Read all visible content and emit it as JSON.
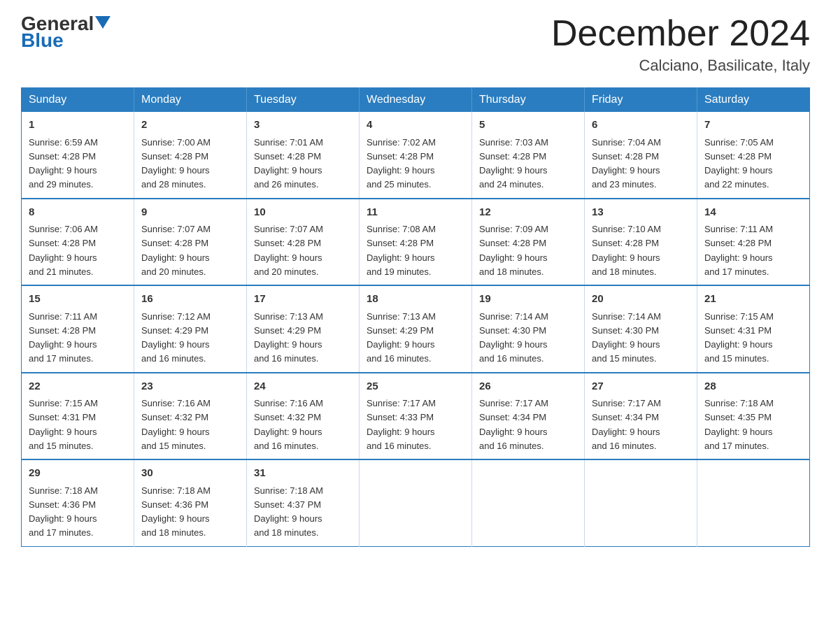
{
  "header": {
    "logo": {
      "general": "General",
      "blue": "Blue",
      "arrow": "▲"
    },
    "title": "December 2024",
    "location": "Calciano, Basilicate, Italy"
  },
  "days_of_week": [
    "Sunday",
    "Monday",
    "Tuesday",
    "Wednesday",
    "Thursday",
    "Friday",
    "Saturday"
  ],
  "weeks": [
    [
      {
        "day": "1",
        "sunrise": "6:59 AM",
        "sunset": "4:28 PM",
        "daylight": "9 hours and 29 minutes."
      },
      {
        "day": "2",
        "sunrise": "7:00 AM",
        "sunset": "4:28 PM",
        "daylight": "9 hours and 28 minutes."
      },
      {
        "day": "3",
        "sunrise": "7:01 AM",
        "sunset": "4:28 PM",
        "daylight": "9 hours and 26 minutes."
      },
      {
        "day": "4",
        "sunrise": "7:02 AM",
        "sunset": "4:28 PM",
        "daylight": "9 hours and 25 minutes."
      },
      {
        "day": "5",
        "sunrise": "7:03 AM",
        "sunset": "4:28 PM",
        "daylight": "9 hours and 24 minutes."
      },
      {
        "day": "6",
        "sunrise": "7:04 AM",
        "sunset": "4:28 PM",
        "daylight": "9 hours and 23 minutes."
      },
      {
        "day": "7",
        "sunrise": "7:05 AM",
        "sunset": "4:28 PM",
        "daylight": "9 hours and 22 minutes."
      }
    ],
    [
      {
        "day": "8",
        "sunrise": "7:06 AM",
        "sunset": "4:28 PM",
        "daylight": "9 hours and 21 minutes."
      },
      {
        "day": "9",
        "sunrise": "7:07 AM",
        "sunset": "4:28 PM",
        "daylight": "9 hours and 20 minutes."
      },
      {
        "day": "10",
        "sunrise": "7:07 AM",
        "sunset": "4:28 PM",
        "daylight": "9 hours and 20 minutes."
      },
      {
        "day": "11",
        "sunrise": "7:08 AM",
        "sunset": "4:28 PM",
        "daylight": "9 hours and 19 minutes."
      },
      {
        "day": "12",
        "sunrise": "7:09 AM",
        "sunset": "4:28 PM",
        "daylight": "9 hours and 18 minutes."
      },
      {
        "day": "13",
        "sunrise": "7:10 AM",
        "sunset": "4:28 PM",
        "daylight": "9 hours and 18 minutes."
      },
      {
        "day": "14",
        "sunrise": "7:11 AM",
        "sunset": "4:28 PM",
        "daylight": "9 hours and 17 minutes."
      }
    ],
    [
      {
        "day": "15",
        "sunrise": "7:11 AM",
        "sunset": "4:28 PM",
        "daylight": "9 hours and 17 minutes."
      },
      {
        "day": "16",
        "sunrise": "7:12 AM",
        "sunset": "4:29 PM",
        "daylight": "9 hours and 16 minutes."
      },
      {
        "day": "17",
        "sunrise": "7:13 AM",
        "sunset": "4:29 PM",
        "daylight": "9 hours and 16 minutes."
      },
      {
        "day": "18",
        "sunrise": "7:13 AM",
        "sunset": "4:29 PM",
        "daylight": "9 hours and 16 minutes."
      },
      {
        "day": "19",
        "sunrise": "7:14 AM",
        "sunset": "4:30 PM",
        "daylight": "9 hours and 16 minutes."
      },
      {
        "day": "20",
        "sunrise": "7:14 AM",
        "sunset": "4:30 PM",
        "daylight": "9 hours and 15 minutes."
      },
      {
        "day": "21",
        "sunrise": "7:15 AM",
        "sunset": "4:31 PM",
        "daylight": "9 hours and 15 minutes."
      }
    ],
    [
      {
        "day": "22",
        "sunrise": "7:15 AM",
        "sunset": "4:31 PM",
        "daylight": "9 hours and 15 minutes."
      },
      {
        "day": "23",
        "sunrise": "7:16 AM",
        "sunset": "4:32 PM",
        "daylight": "9 hours and 15 minutes."
      },
      {
        "day": "24",
        "sunrise": "7:16 AM",
        "sunset": "4:32 PM",
        "daylight": "9 hours and 16 minutes."
      },
      {
        "day": "25",
        "sunrise": "7:17 AM",
        "sunset": "4:33 PM",
        "daylight": "9 hours and 16 minutes."
      },
      {
        "day": "26",
        "sunrise": "7:17 AM",
        "sunset": "4:34 PM",
        "daylight": "9 hours and 16 minutes."
      },
      {
        "day": "27",
        "sunrise": "7:17 AM",
        "sunset": "4:34 PM",
        "daylight": "9 hours and 16 minutes."
      },
      {
        "day": "28",
        "sunrise": "7:18 AM",
        "sunset": "4:35 PM",
        "daylight": "9 hours and 17 minutes."
      }
    ],
    [
      {
        "day": "29",
        "sunrise": "7:18 AM",
        "sunset": "4:36 PM",
        "daylight": "9 hours and 17 minutes."
      },
      {
        "day": "30",
        "sunrise": "7:18 AM",
        "sunset": "4:36 PM",
        "daylight": "9 hours and 18 minutes."
      },
      {
        "day": "31",
        "sunrise": "7:18 AM",
        "sunset": "4:37 PM",
        "daylight": "9 hours and 18 minutes."
      },
      null,
      null,
      null,
      null
    ]
  ],
  "labels": {
    "sunrise": "Sunrise:",
    "sunset": "Sunset:",
    "daylight": "Daylight:"
  }
}
